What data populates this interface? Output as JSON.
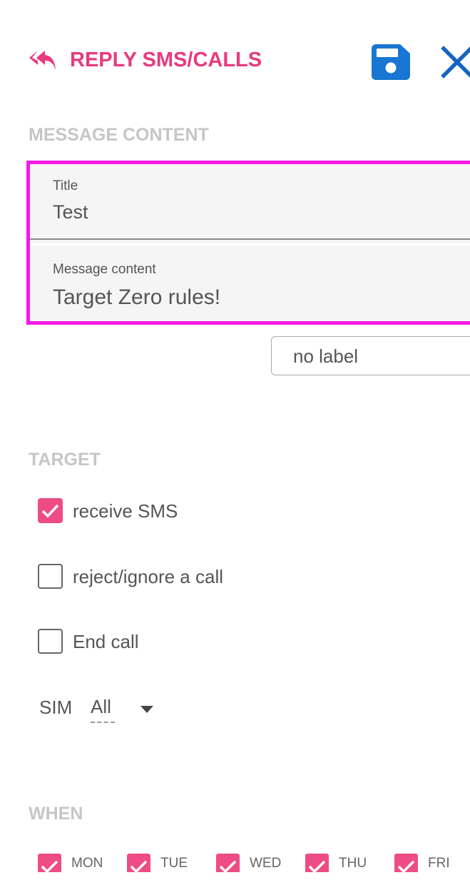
{
  "header": {
    "title": "REPLY SMS/CALLS",
    "back_icon": "reply-all-icon",
    "save_icon": "floppy-disk-icon",
    "close_icon": "close-icon"
  },
  "message_section": {
    "title": "MESSAGE CONTENT",
    "title_field": {
      "label": "Title",
      "value": "Test"
    },
    "content_field": {
      "label": "Message content",
      "value": "Target Zero rules!"
    },
    "label_select": {
      "value": "no label"
    }
  },
  "target_section": {
    "title": "TARGET",
    "options": [
      {
        "label": "receive SMS",
        "checked": true
      },
      {
        "label": "reject/ignore a call",
        "checked": false
      },
      {
        "label": "End call",
        "checked": false
      }
    ],
    "sim": {
      "label": "SIM",
      "value": "All"
    }
  },
  "when_section": {
    "title": "WHEN",
    "days": [
      {
        "label": "MON",
        "checked": true
      },
      {
        "label": "TUE",
        "checked": true
      },
      {
        "label": "WED",
        "checked": true
      },
      {
        "label": "THU",
        "checked": true
      },
      {
        "label": "FRI",
        "checked": true
      }
    ]
  },
  "colors": {
    "accent": "#e83a7e",
    "checkbox": "#ee4c85",
    "save_icon": "#1976d2",
    "close_icon": "#1565c0",
    "highlight_border": "#f419e6",
    "section_title": "#c6c6c6"
  }
}
